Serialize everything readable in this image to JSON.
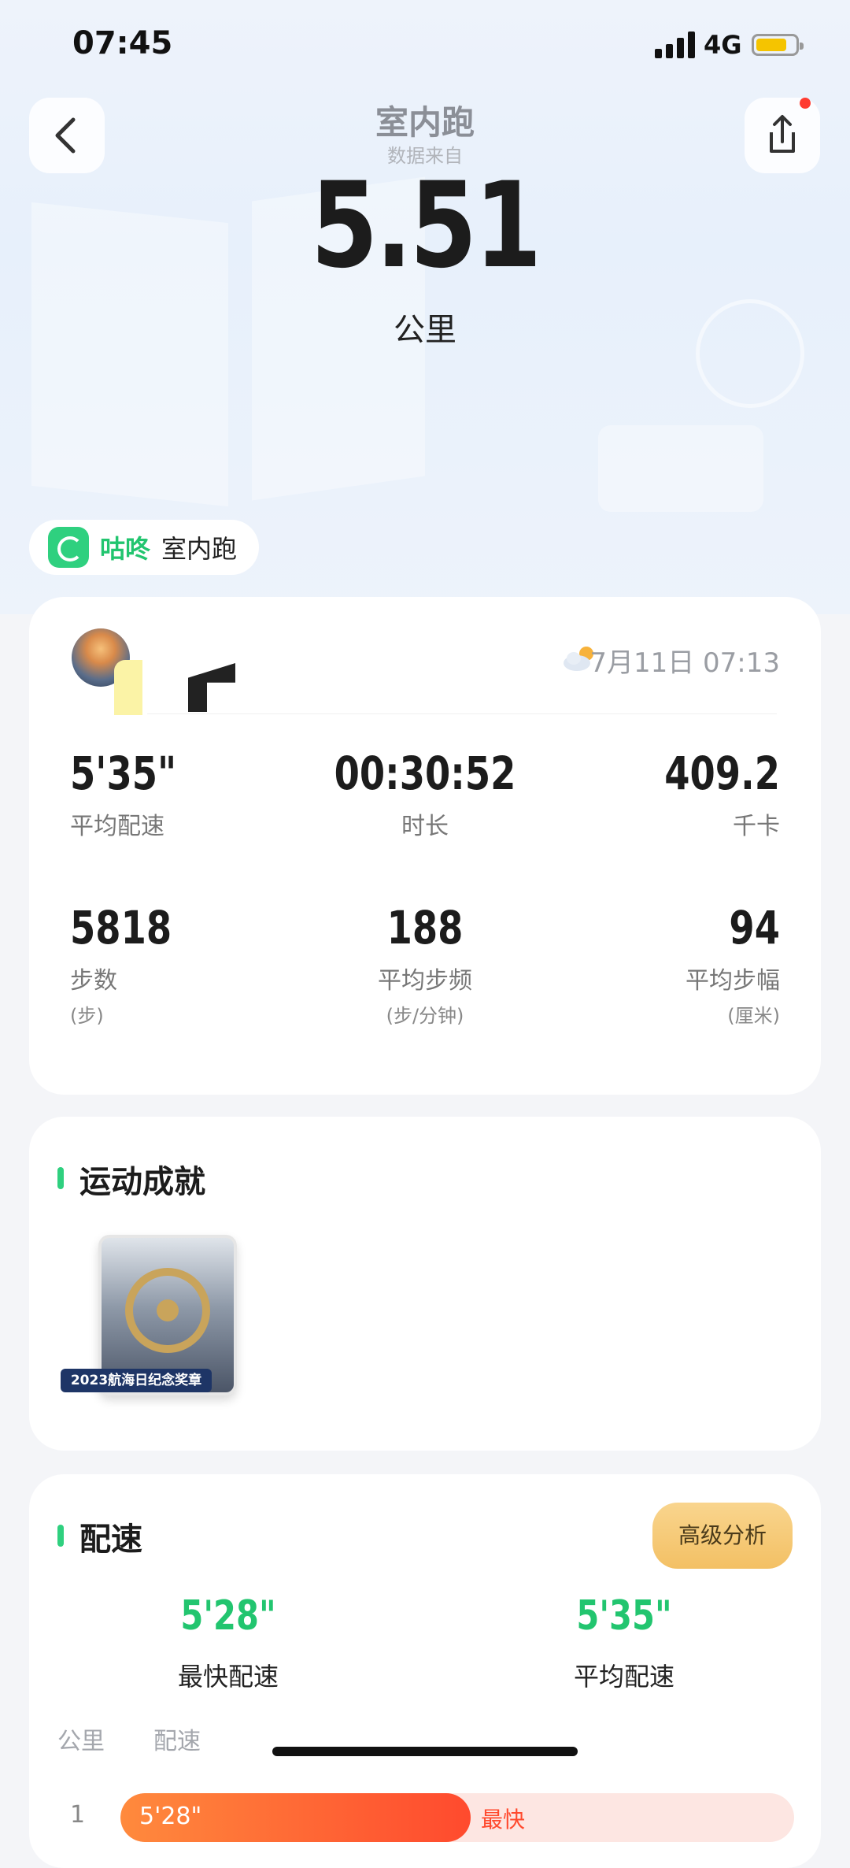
{
  "status_bar": {
    "time": "07:45",
    "network": "4G"
  },
  "nav": {
    "title": "室内跑",
    "subtitle": "数据来自"
  },
  "hero": {
    "distance": "5.51",
    "unit": "公里"
  },
  "source": {
    "brand": "咕咚",
    "type": "室内跑"
  },
  "summary": {
    "date": "7月11日 07:13",
    "stats": [
      {
        "value": "5'35\"",
        "label": "平均配速",
        "unit": ""
      },
      {
        "value": "00:30:52",
        "label": "时长",
        "unit": ""
      },
      {
        "value": "409.2",
        "label": "千卡",
        "unit": ""
      },
      {
        "value": "5818",
        "label": "步数",
        "unit": "(步)"
      },
      {
        "value": "188",
        "label": "平均步频",
        "unit": "(步/分钟)"
      },
      {
        "value": "94",
        "label": "平均步幅",
        "unit": "(厘米)"
      }
    ]
  },
  "achievements": {
    "title": "运动成就",
    "medal_label": "2023航海日纪念奖章"
  },
  "pace": {
    "title": "配速",
    "advanced_button": "高级分析",
    "fastest": {
      "value": "5'28\"",
      "label": "最快配速"
    },
    "average": {
      "value": "5'35\"",
      "label": "平均配速"
    },
    "columns": [
      "公里",
      "配速"
    ],
    "rows": [
      {
        "km": "1",
        "pace": "5'28\"",
        "tag": "最快",
        "fill_fraction": 0.52
      }
    ]
  },
  "colors": {
    "accent_green": "#22c56f",
    "pace_red": "#ff4a2e",
    "gold": "#f3c064"
  }
}
